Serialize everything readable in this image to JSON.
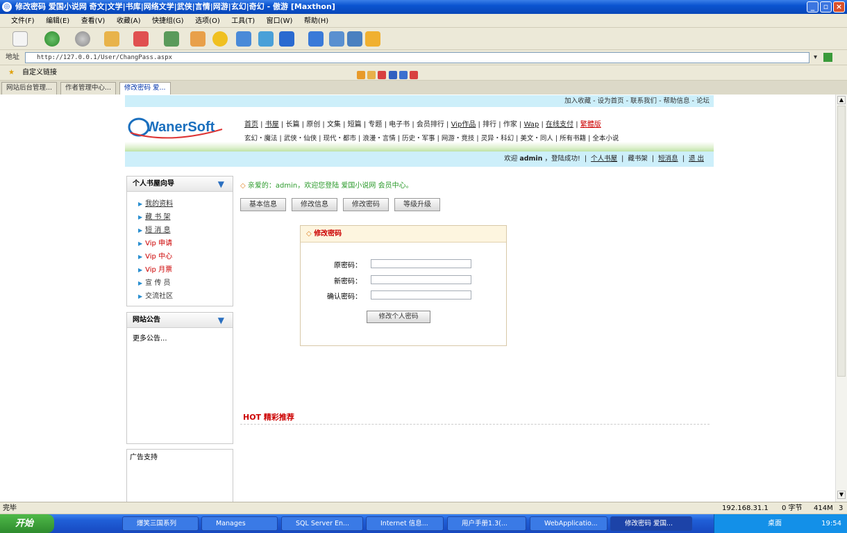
{
  "window": {
    "title": "修改密码 爱国小说网 奇文|文学|书库|网络文学|武侠|言情|网游|玄幻|奇幻 - 傲游 [Maxthon]"
  },
  "menu": [
    "文件(F)",
    "编辑(E)",
    "查看(V)",
    "收藏(A)",
    "快捷组(G)",
    "选项(O)",
    "工具(T)",
    "窗口(W)",
    "帮助(H)"
  ],
  "address": {
    "label": "地址",
    "url": "http://127.0.0.1/User/ChangPass.aspx"
  },
  "favbar": {
    "label": "自定义链接"
  },
  "tabs": [
    "网站后台管理...",
    "作者管理中心...",
    "修改密码 爱..."
  ],
  "site": {
    "top_links": "加入收藏 - 设为首页 - 联系我们 - 帮助信息 - 论坛",
    "logo": "WanerSoft",
    "nav_primary": [
      "首页",
      "书屋",
      "长篇",
      "原创",
      "文集",
      "短篇",
      "专题",
      "电子书",
      "会员排行",
      "Vip作品",
      "排行",
      "作家",
      "Wap",
      "在线支付",
      "繁體版"
    ],
    "nav_secondary": [
      "玄幻・魔法",
      "武侠・仙侠",
      "现代・都市",
      "浪漫・言情",
      "历史・军事",
      "网游・竞技",
      "灵异・科幻",
      "美文・同人",
      "所有书籍",
      "全本小说"
    ],
    "welcome": {
      "prefix": "欢迎",
      "user": "admin",
      "suffix": "，登陆成功!",
      "links": [
        "个人书屋",
        "藏书架",
        "短消息",
        "退 出"
      ]
    }
  },
  "sidebar": {
    "nav_title": "个人书屋向导",
    "items": [
      "我的资料",
      "藏 书 架",
      "短 消 息",
      "Vip 申请",
      "Vip 中心",
      "Vip 月票",
      "宣 传 员",
      "交流社区"
    ],
    "notice_title": "网站公告",
    "notice_more": "更多公告...",
    "ad_title": "广告支持"
  },
  "main": {
    "greeting": "亲爱的：admin，欢迎您登陆 爱国小说网 会员中心。",
    "tabs": [
      "基本信息",
      "修改信息",
      "修改密码",
      "等级升级"
    ],
    "form": {
      "title": "修改密码",
      "old_label": "原密码：",
      "new_label": "新密码：",
      "confirm_label": "确认密码：",
      "submit": "修改个人密码"
    },
    "hot_title": "HOT 精彩推荐"
  },
  "statusbar": {
    "text": "完毕",
    "right": [
      "192.168.31.1",
      "0 字节",
      "414M",
      "3"
    ]
  },
  "taskbar": {
    "start": "开始",
    "items": [
      "爆笑三国系列",
      "Manages",
      "SQL Server En...",
      "Internet 信息...",
      "用户手册1.3(...",
      "WebApplicatio...",
      "修改密码 爱国..."
    ],
    "tray": {
      "desktop": "桌面",
      "clock": "19:54"
    }
  },
  "colors": {
    "accent": "#cdeffa",
    "link_red": "#cc0000",
    "title_blue": "#0a54d0"
  }
}
